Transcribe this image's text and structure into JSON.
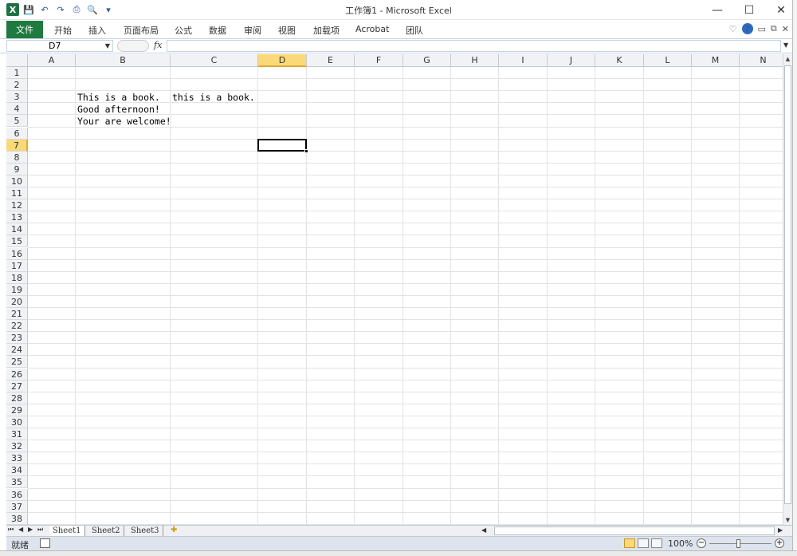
{
  "window": {
    "title": "工作簿1 - Microsoft Excel",
    "minimize": "—",
    "maximize": "☐",
    "close": "✕"
  },
  "qat": {
    "logo": "X",
    "save": "💾",
    "undo": "↶",
    "redo": "↷",
    "print": "⎙",
    "preview": "🔍",
    "customize": "▾"
  },
  "ribbon": {
    "file": "文件",
    "tabs": [
      "开始",
      "插入",
      "页面布局",
      "公式",
      "数据",
      "审阅",
      "视图",
      "加载项",
      "Acrobat",
      "团队"
    ],
    "help": "?"
  },
  "formula_bar": {
    "name_box": "D7",
    "fx": "fx",
    "formula": ""
  },
  "grid": {
    "columns": [
      "A",
      "B",
      "C",
      "D",
      "E",
      "F",
      "G",
      "H",
      "I",
      "J",
      "K",
      "L",
      "M",
      "N"
    ],
    "active_column": "D",
    "active_row": 7,
    "rows": 38,
    "cells": [
      {
        "ref": "B3",
        "text": "This is a book."
      },
      {
        "ref": "C3",
        "text": "this is a book."
      },
      {
        "ref": "B4",
        "text": "Good afternoon!"
      },
      {
        "ref": "B5",
        "text": "Your are welcome!"
      }
    ]
  },
  "sheets": {
    "tabs": [
      "Sheet1",
      "Sheet2",
      "Sheet3"
    ],
    "active": "Sheet1"
  },
  "status": {
    "mode": "就绪",
    "zoom": "100%",
    "zoom_value": 100
  }
}
